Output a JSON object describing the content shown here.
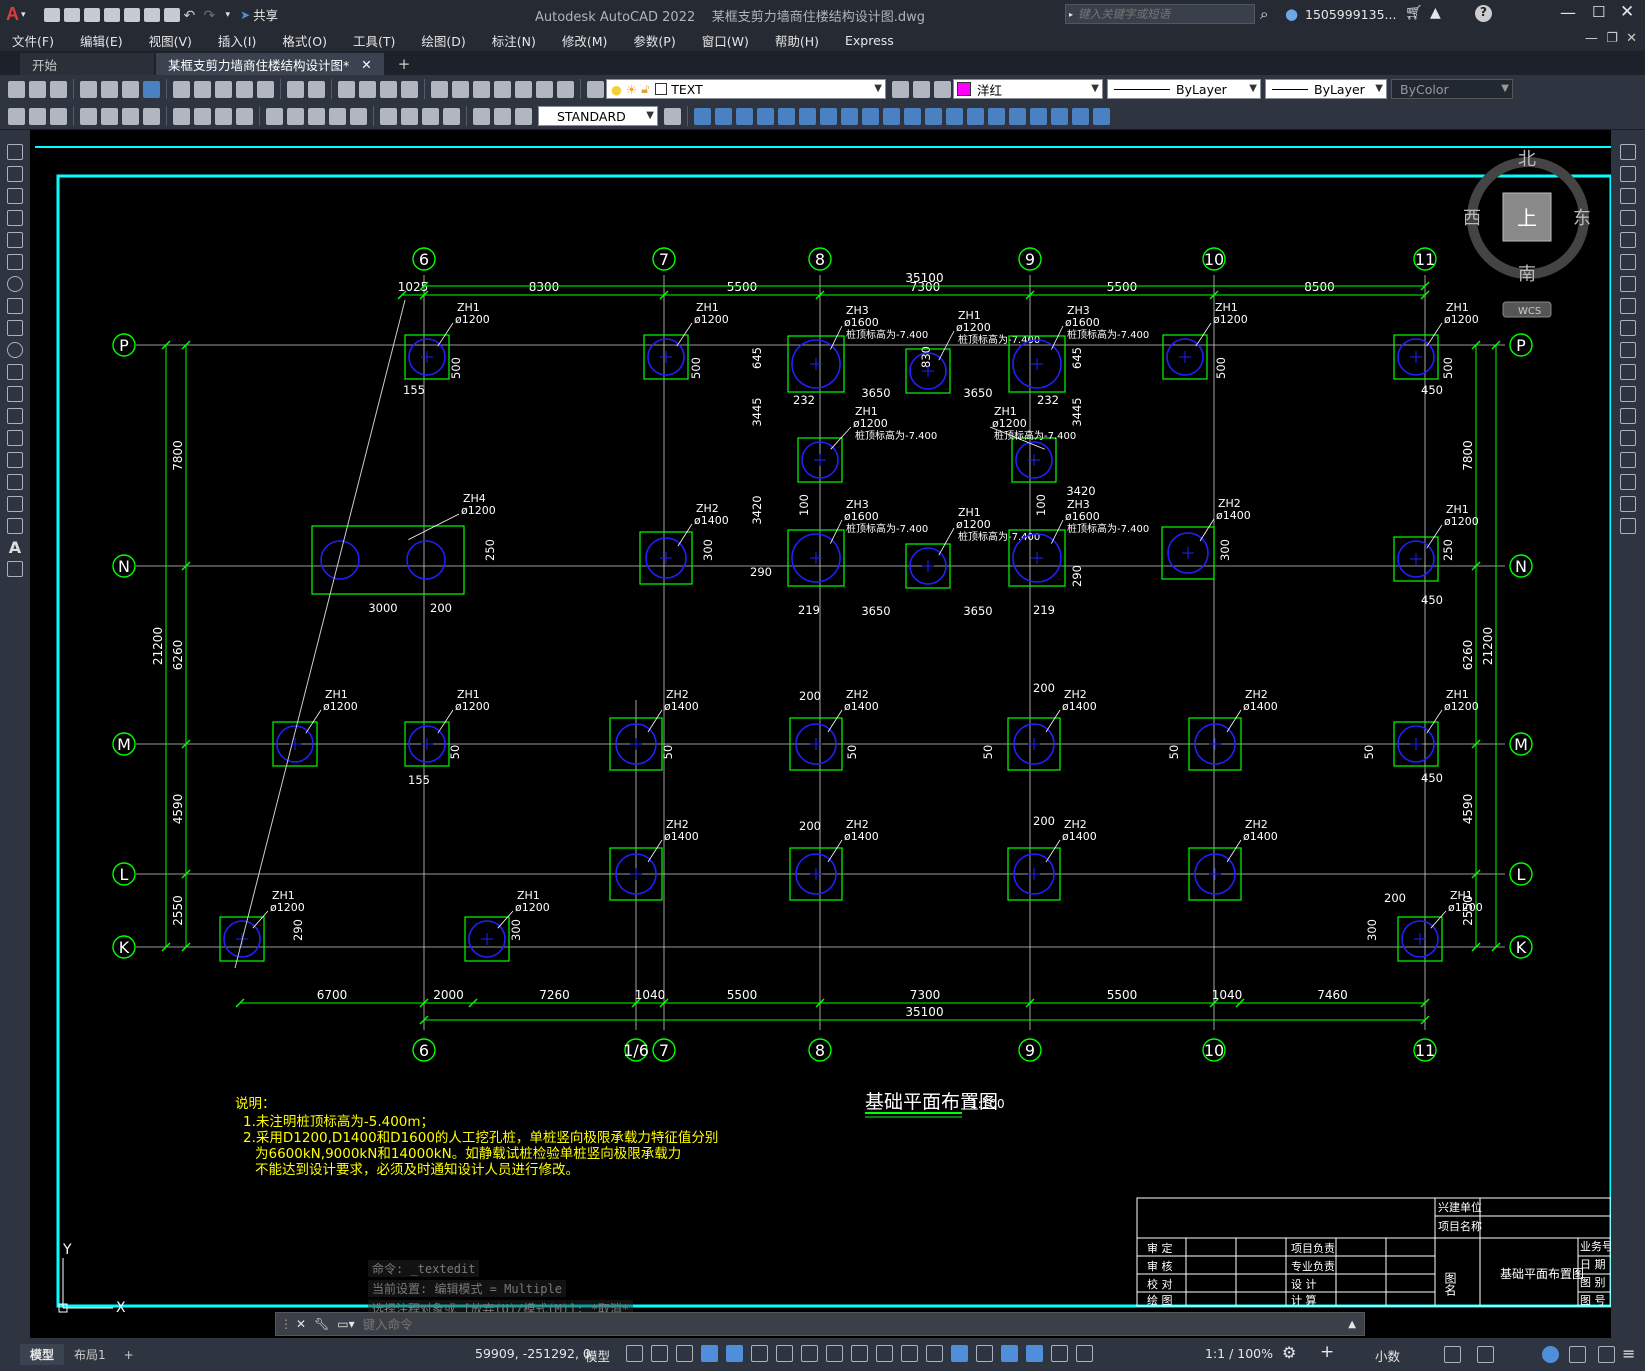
{
  "app": {
    "title": "Autodesk AutoCAD 2022",
    "file": "某框支剪力墙商住楼结构设计图.dwg",
    "share": "共享",
    "search_placeholder": "键入关键字或短语",
    "user": "1505999135...",
    "app_letter": "A"
  },
  "menu": [
    "文件(F)",
    "编辑(E)",
    "视图(V)",
    "插入(I)",
    "格式(O)",
    "工具(T)",
    "绘图(D)",
    "标注(N)",
    "修改(M)",
    "参数(P)",
    "窗口(W)",
    "帮助(H)",
    "Express"
  ],
  "tabs": [
    {
      "label": "开始"
    },
    {
      "label": "某框支剪力墙商住楼结构设计图*"
    }
  ],
  "toolbar": {
    "layer": "TEXT",
    "color": "洋红",
    "linetype": "ByLayer",
    "lineweight": "ByLayer",
    "plotstyle": "ByColor",
    "textstyle": "STANDARD"
  },
  "colors": {
    "cyan": "#00ffff",
    "green": "#00ff00",
    "blue": "#2020ff",
    "white": "#ffffff",
    "yellow": "#ffff00",
    "magenta": "#ff00ff"
  },
  "viewcube": {
    "north": "北",
    "south": "南",
    "east": "东",
    "west": "西",
    "top": "上",
    "wcs": "WCS"
  },
  "grid": {
    "columns": [
      "6",
      "7",
      "8",
      "9",
      "10",
      "11"
    ],
    "extra_column": "1/6",
    "rows": [
      "P",
      "N",
      "M",
      "L",
      "K"
    ],
    "top_dims": [
      "1025",
      "8300",
      "5500",
      "7300",
      "5500",
      "8500"
    ],
    "top_total": "35100",
    "bottom_dims": [
      "6700",
      "2000",
      "7260",
      "1040",
      "5500",
      "7300",
      "5500",
      "1040",
      "7460"
    ],
    "bottom_total": "35100",
    "left_dims": [
      "7800",
      "6260",
      "4590",
      "2550"
    ],
    "left_total": "21200",
    "right_dims": [
      "7800",
      "6260",
      "4590",
      "2550"
    ],
    "right_total": "21200"
  },
  "piles": [
    {
      "code": "ZH1",
      "dia": "ø1200"
    },
    {
      "code": "ZH1",
      "dia": "ø1200"
    },
    {
      "code": "ZH3",
      "dia": "ø1600",
      "elev": "桩顶标高为-7.400"
    },
    {
      "code": "ZH1",
      "dia": "ø1200",
      "elev": "桩顶标高为-7.400"
    },
    {
      "code": "ZH3",
      "dia": "ø1600",
      "elev": "桩顶标高为-7.400"
    },
    {
      "code": "ZH1",
      "dia": "ø1200"
    },
    {
      "code": "ZH1",
      "dia": "ø1200"
    },
    {
      "code": "ZH1",
      "dia": "ø1200",
      "elev": "桩顶标高为-7.400"
    },
    {
      "code": "ZH1",
      "dia": "ø1200",
      "elev": "桩顶标高为-7.400"
    },
    {
      "code": "ZH4",
      "dia": "ø1200"
    },
    {
      "code": "ZH2",
      "dia": "ø1400"
    },
    {
      "code": "ZH3",
      "dia": "ø1600",
      "elev": "桩顶标高为-7.400"
    },
    {
      "code": "ZH1",
      "dia": "ø1200",
      "elev": "桩顶标高为-7.400"
    },
    {
      "code": "ZH3",
      "dia": "ø1600",
      "elev": "桩顶标高为-7.400"
    },
    {
      "code": "ZH2",
      "dia": "ø1400"
    },
    {
      "code": "ZH1",
      "dia": "ø1200"
    },
    {
      "code": "ZH1",
      "dia": "ø1200"
    },
    {
      "code": "ZH1",
      "dia": "ø1200"
    },
    {
      "code": "ZH2",
      "dia": "ø1400"
    },
    {
      "code": "ZH2",
      "dia": "ø1400"
    },
    {
      "code": "ZH2",
      "dia": "ø1400"
    },
    {
      "code": "ZH2",
      "dia": "ø1400"
    },
    {
      "code": "ZH1",
      "dia": "ø1200"
    },
    {
      "code": "ZH2",
      "dia": "ø1400"
    },
    {
      "code": "ZH2",
      "dia": "ø1400"
    },
    {
      "code": "ZH2",
      "dia": "ø1400"
    },
    {
      "code": "ZH2",
      "dia": "ø1400"
    },
    {
      "code": "ZH1",
      "dia": "ø1200"
    },
    {
      "code": "ZH1",
      "dia": "ø1200"
    },
    {
      "code": "ZH1",
      "dia": "ø1200"
    }
  ],
  "dims_misc": [
    "155",
    "500",
    "500",
    "645",
    "232",
    "3650",
    "3650",
    "232",
    "645",
    "830",
    "500",
    "500",
    "450",
    "3445",
    "3445",
    "100",
    "100",
    "3420",
    "3420",
    "290",
    "219",
    "3650",
    "3650",
    "219",
    "290",
    "250",
    "300",
    "300",
    "250",
    "450",
    "3000",
    "200",
    "50",
    "155",
    "50",
    "50",
    "50",
    "50",
    "50",
    "450",
    "200",
    "200",
    "200",
    "200",
    "200",
    "290",
    "300",
    "300",
    "300"
  ],
  "drawing_title": "基础平面布置图",
  "drawing_scale": "1:100",
  "notes": {
    "heading": "说明：",
    "lines": [
      "1.未注明桩顶标高为-5.400m；",
      "2.采用D1200,D1400和D1600的人工挖孔桩，单桩竖向极限承载力特征值分别",
      "为6600kN,9000kN和14000kN。如静载试桩检验单桩竖向极限承载力",
      "不能达到设计要求，必须及时通知设计人员进行修改。"
    ]
  },
  "titleblock": {
    "units": "兴建单位",
    "project": "项目名称",
    "roles_left": [
      "审 定",
      "审 核",
      "校 对",
      "绘 图"
    ],
    "roles_mid": [
      "项目负责",
      "专业负责",
      "设 计",
      "计 算"
    ],
    "figname_label": "图名",
    "figname": "基础平面布置图",
    "right": [
      "业务号",
      "日 期",
      "图 别",
      "图 号"
    ]
  },
  "axis_labels": {
    "y": "Y",
    "x": "X"
  },
  "command": {
    "history": [
      "命令: _textedit",
      "当前设置: 编辑模式 = Multiple",
      "选择注释对象或 [放弃(U)/模式(M)]: *取消*"
    ],
    "placeholder": "键入命令"
  },
  "status": {
    "model_tab": "模型",
    "layout_tab": "布局1",
    "coords": "59909, -251292, 0",
    "model": "模型",
    "scale": "1:1 / 100%",
    "units": "小数"
  }
}
